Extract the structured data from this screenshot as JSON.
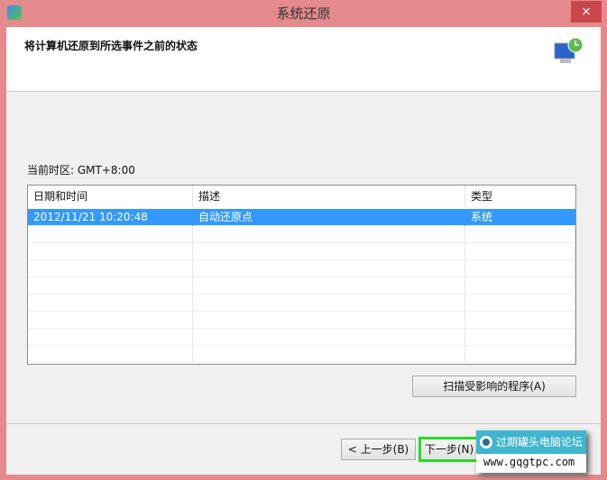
{
  "window": {
    "title": "系统还原",
    "close": "×"
  },
  "header": {
    "heading": "将计算机还原到所选事件之前的状态"
  },
  "timezone": "当前时区: GMT+8:00",
  "table": {
    "columns": [
      "日期和时间",
      "描述",
      "类型"
    ],
    "rows": [
      {
        "date": "2012/11/21 10:20:48",
        "description": "自动还原点",
        "type": "系统",
        "selected": true
      }
    ]
  },
  "buttons": {
    "scan": "扫描受影响的程序(A)",
    "back": "< 上一步(B)",
    "next": "下一步(N)"
  },
  "watermark": {
    "name": "过期罐头电脑论坛",
    "url": "www.gqgtpc.com"
  },
  "colors": {
    "frame": "#e48a8c",
    "selection": "#3399ff",
    "highlight": "#22dd22"
  }
}
